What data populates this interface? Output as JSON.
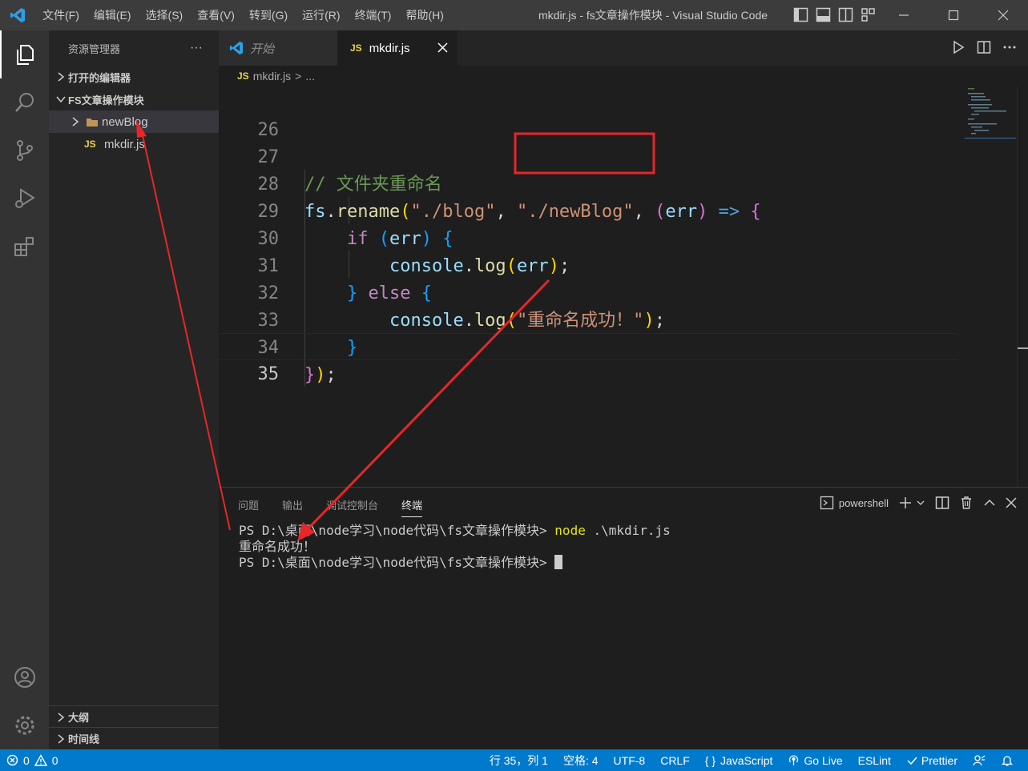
{
  "titlebar": {
    "menu": [
      "文件(F)",
      "编辑(E)",
      "选择(S)",
      "查看(V)",
      "转到(G)",
      "运行(R)",
      "终端(T)",
      "帮助(H)"
    ],
    "window_title": "mkdir.js - fs文章操作模块 - Visual Studio Code"
  },
  "sidebar": {
    "header": "资源管理器",
    "more": "···",
    "open_editors": "打开的编辑器",
    "folder": "FS文章操作模块",
    "items": [
      {
        "label": "newBlog",
        "type": "folder"
      },
      {
        "label": "mkdir.js",
        "type": "js"
      }
    ],
    "outline": "大纲",
    "timeline": "时间线"
  },
  "tabs": [
    {
      "label": "开始",
      "active": false
    },
    {
      "label": "mkdir.js",
      "badge": "JS",
      "active": true
    }
  ],
  "breadcrumb": {
    "badge": "JS",
    "file": "mkdir.js",
    "sep": ">",
    "rest": "..."
  },
  "editor": {
    "line_numbers": [
      "26",
      "27",
      "28",
      "29",
      "30",
      "31",
      "32",
      "33",
      "34",
      "35"
    ],
    "current_line": "35",
    "code": {
      "l27_comment": "// 文件夹重命名",
      "l28_fs": "fs",
      "l28_dot": ".",
      "l28_rename": "rename",
      "l28_open": "(",
      "l28_str1": "\"./blog\"",
      "l28_comma1": ", ",
      "l28_str2": "\"./newBlog\"",
      "l28_comma2": ", ",
      "l28_p_open": "(",
      "l28_err": "err",
      "l28_p_close": ")",
      "l28_arrow": " => ",
      "l28_brace": "{",
      "l29_if": "if",
      "l29_open": "(",
      "l29_err": "err",
      "l29_close": ")",
      "l29_brace": "{",
      "l30_console": "console",
      "l30_dot": ".",
      "l30_log": "log",
      "l30_open": "(",
      "l30_err": "err",
      "l30_close": ")",
      "l30_semi": ";",
      "l31_close": "}",
      "l31_else": "else",
      "l31_brace": "{",
      "l32_console": "console",
      "l32_dot": ".",
      "l32_log": "log",
      "l32_open": "(",
      "l32_str": "\"重命名成功！\"",
      "l32_close": ")",
      "l32_semi": ";",
      "l33_close": "}",
      "l34_brace": "}",
      "l34_paren": ")",
      "l34_semi": ";"
    }
  },
  "panel": {
    "tabs": [
      "问题",
      "输出",
      "调试控制台",
      "终端"
    ],
    "active_tab": "终端",
    "shell": "powershell",
    "terminal": {
      "prompt1": "PS D:\\桌面\\node学习\\node代码\\fs文章操作模块> ",
      "cmd_name": "node",
      "cmd_args": " .\\mkdir.js",
      "output": "重命名成功！",
      "prompt2": "PS D:\\桌面\\node学习\\node代码\\fs文章操作模块> "
    }
  },
  "statusbar": {
    "errors": "0",
    "warnings": "0",
    "position": "行 35，列 1",
    "spaces": "空格: 4",
    "encoding": "UTF-8",
    "eol": "CRLF",
    "language": "JavaScript",
    "golive": "Go Live",
    "eslint": "ESLint",
    "prettier": "Prettier"
  },
  "colors": {
    "accent": "#007acc",
    "annotation": "#e8262a"
  }
}
